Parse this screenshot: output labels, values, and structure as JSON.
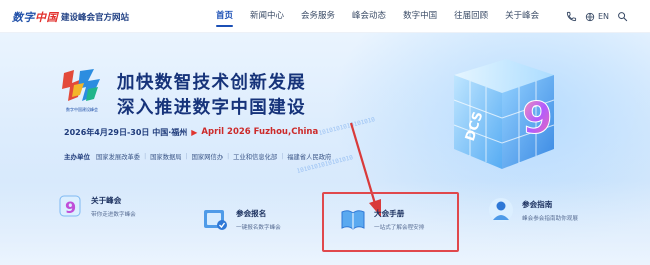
{
  "brand": {
    "logo_text_blue": "数字",
    "logo_text_red": "中国",
    "site_name": "建设峰会官方网站"
  },
  "nav": {
    "items": [
      {
        "label": "首页",
        "active": true
      },
      {
        "label": "新闻中心",
        "active": false
      },
      {
        "label": "会务服务",
        "active": false
      },
      {
        "label": "峰会动态",
        "active": false
      },
      {
        "label": "数字中国",
        "active": false
      },
      {
        "label": "往届回顾",
        "active": false
      },
      {
        "label": "关于峰会",
        "active": false
      }
    ],
    "tools": {
      "phone_icon": "phone-icon",
      "lang_icon": "globe-icon",
      "lang_label": "EN",
      "search_icon": "search-icon"
    }
  },
  "hero": {
    "logo_caption": "数字中国建设峰会",
    "title_line1": "加快数智技术创新发展",
    "title_line2": "深入推进数字中国建设",
    "date_cn": "2026年4月29日-30日  中国·福州",
    "date_en": "April 2026  Fuzhou,China",
    "organizer_label": "主办单位",
    "organizers": [
      "国家发展改革委",
      "国家数据局",
      "国家网信办",
      "工业和信息化部",
      "福建省人民政府"
    ],
    "cube_badge": "DCS",
    "cube_number": "9",
    "binary_text": "1010101010101010"
  },
  "cards": [
    {
      "title": "关于峰会",
      "subtitle": "带你走进数字峰会",
      "icon": "nine-badge-icon"
    },
    {
      "title": "参会报名",
      "subtitle": "一键报名数字峰会",
      "icon": "register-icon"
    },
    {
      "title": "大会手册",
      "subtitle": "一站式了解会程安排",
      "icon": "manual-book-icon"
    },
    {
      "title": "参会指南",
      "subtitle": "峰会参会指南助你观展",
      "icon": "guide-person-icon"
    }
  ],
  "colors": {
    "nav_active": "#1b4fb5",
    "title": "#16337a",
    "date_accent": "#cc2a2a",
    "highlight": "#e0484c",
    "arrow": "#d93a3a"
  }
}
